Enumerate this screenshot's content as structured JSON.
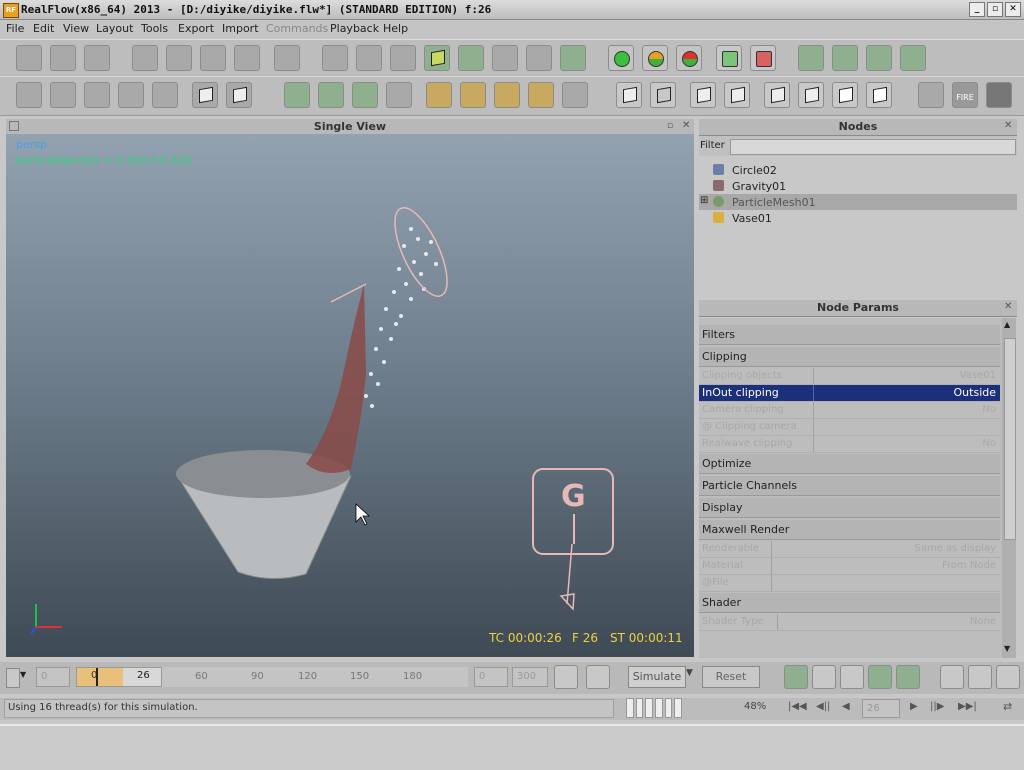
{
  "window": {
    "title": "RealFlow(x86_64) 2013 - [D:/diyike/diyike.flw*] (STANDARD EDITION) f:26",
    "app_icon_text": "RF",
    "min_label": "_",
    "max_label": "▫",
    "close_label": "✕"
  },
  "menu": [
    "File",
    "Edit",
    "View",
    "Layout",
    "Tools",
    "Export",
    "Import",
    "Commands",
    "Playback",
    "Help"
  ],
  "viewport": {
    "title": "Single View",
    "camera_label": "persp",
    "selected_label": "ParticleMesh01 = 0.350 F:0.320",
    "timecode": "TC 00:00:26",
    "frame": "F 26",
    "sim_time": "ST 00:00:11",
    "gravity_letter": "G"
  },
  "nodes_panel": {
    "title": "Nodes",
    "filter_label": "Filter",
    "items": [
      {
        "label": "Circle02",
        "icon": "emitter-icon",
        "color": "#6a7fa8"
      },
      {
        "label": "Gravity01",
        "icon": "daemon-icon",
        "color": "#8a6a6a"
      },
      {
        "label": "ParticleMesh01",
        "icon": "mesh-icon",
        "color": "#7a9a6a"
      },
      {
        "label": "Vase01",
        "icon": "object-icon",
        "color": "#d8b040"
      }
    ]
  },
  "params_panel": {
    "title": "Node Params",
    "sections": {
      "filters": "Filters",
      "clipping": "Clipping",
      "optimize": "Optimize",
      "particle_channels": "Particle Channels",
      "display": "Display",
      "maxwell_render": "Maxwell Render",
      "shader": "Shader"
    },
    "clipping_rows": [
      {
        "name": "Clipping objects",
        "value": "Vase01"
      },
      {
        "name": "InOut clipping",
        "value": "Outside"
      },
      {
        "name": "Camera clipping",
        "value": "No"
      },
      {
        "name": "@ Clipping camera",
        "value": ""
      },
      {
        "name": "Realwave clipping",
        "value": "No"
      }
    ],
    "maxwell_rows": [
      {
        "name": "Renderable",
        "value": "Same as display"
      },
      {
        "name": "Material",
        "value": "From Node"
      },
      {
        "name": "@File",
        "value": ""
      }
    ],
    "shader_rows": [
      {
        "name": "Shader Type",
        "value": "None"
      }
    ]
  },
  "timeline": {
    "start_field": "0",
    "current_frame": "26",
    "range_start": "0",
    "ticks": [
      "60",
      "90",
      "120",
      "150",
      "180"
    ],
    "end_field_a": "0",
    "end_field_b": "300",
    "simulate_label": "Simulate",
    "reset_label": "Reset"
  },
  "status": {
    "message": "Using 16 thread(s) for this simulation.",
    "progress_percent": "48%",
    "frame_field": "26"
  },
  "colors": {
    "selection": "#1c2f7a",
    "viewport_text_blue": "#4aa0e8",
    "viewport_text_green": "#33d07a",
    "hud_yellow": "#f0d040",
    "gizmo_pink": "#e8b8b8"
  }
}
